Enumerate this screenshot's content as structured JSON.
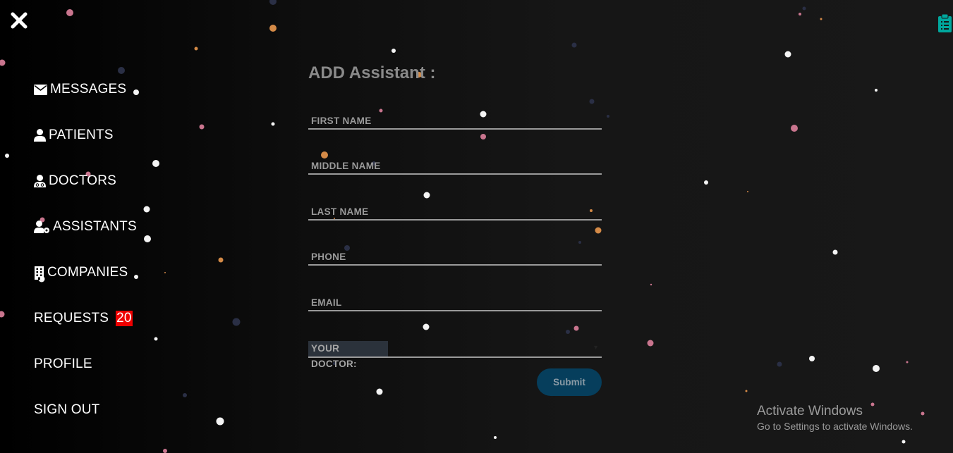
{
  "sidebar": {
    "items": [
      {
        "label": "MESSAGES",
        "icon": "envelope-icon"
      },
      {
        "label": "PATIENTS",
        "icon": "user-icon"
      },
      {
        "label": "DOCTORS",
        "icon": "user-doctor-icon"
      },
      {
        "label": "ASSISTANTS",
        "icon": "user-gear-icon"
      },
      {
        "label": "COMPANIES",
        "icon": "building-icon"
      },
      {
        "label": "REQUESTS",
        "badge": "20"
      },
      {
        "label": "PROFILE"
      },
      {
        "label": "SIGN OUT"
      }
    ]
  },
  "form": {
    "title": "ADD Assistant :",
    "fields": [
      {
        "label": "FIRST NAME"
      },
      {
        "label": "MIDDLE NAME"
      },
      {
        "label": "LAST NAME"
      },
      {
        "label": "PHONE"
      },
      {
        "label": "EMAIL"
      }
    ],
    "doctor_select": {
      "value": "YOUR DOCTOR:"
    },
    "submit_label": "Submit"
  },
  "watermark": {
    "title": "Activate Windows",
    "subtitle": "Go to Settings to activate Windows."
  },
  "colors": {
    "badge": "#ee0000",
    "submit_bg": "#063e5c",
    "clipboard": "#00a79d"
  }
}
